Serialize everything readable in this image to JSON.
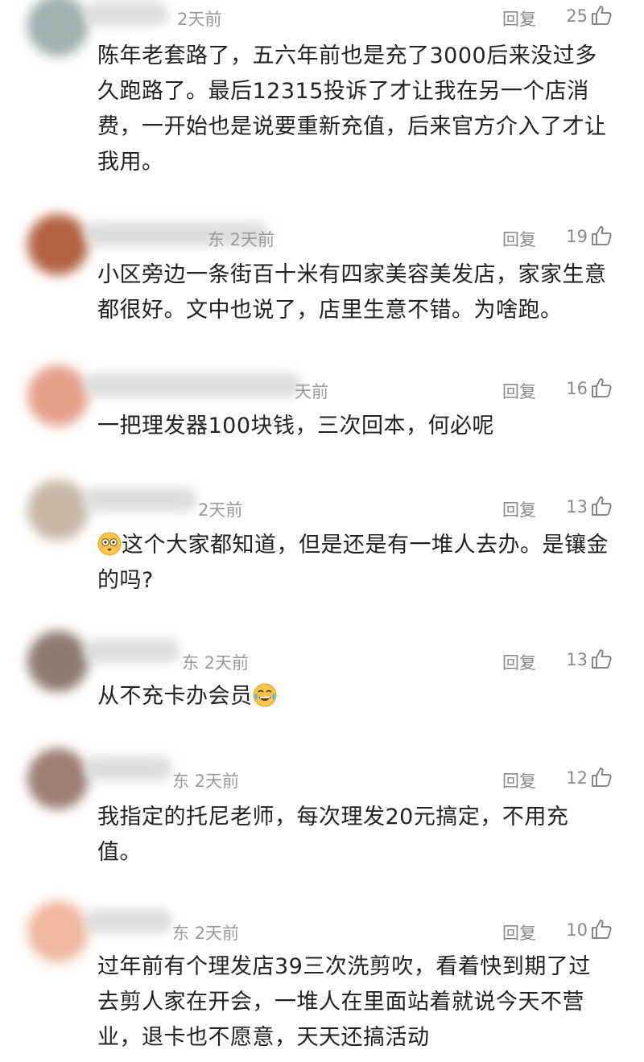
{
  "ui": {
    "reply_label": "回复"
  },
  "comments": [
    {
      "meta": "2天前",
      "likes": "25",
      "text": "陈年老套路了，五六年前也是充了3000后来没过多久跑路了。最后12315投诉了才让我在另一个店消费，一开始也是说要重新充值，后来官方介入了才让我用。",
      "avatar_color": "#9fb0ad"
    },
    {
      "meta": "东 2天前",
      "likes": "19",
      "text": "小区旁边一条街百十米有四家美容美发店，家家生意都很好。文中也说了，店里生意不错。为啥跑。",
      "avatar_color": "#b46442"
    },
    {
      "meta": "天前",
      "likes": "16",
      "text": "一把理发器100块钱，三次回本，何必呢",
      "avatar_color": "#e6a08a"
    },
    {
      "meta": "2天前",
      "likes": "13",
      "text_before": "",
      "emoji_before": "flushed-face-emoji",
      "text": "这个大家都知道，但是还是有一堆人去办。是镶金的吗?",
      "avatar_color": "#c9b7a6"
    },
    {
      "meta": "东 2天前",
      "likes": "13",
      "text": "从不充卡办会员",
      "emoji_after": "tears-of-joy-emoji",
      "avatar_color": "#8f7a6f"
    },
    {
      "meta": "东 2天前",
      "likes": "12",
      "text": "我指定的托尼老师，每次理发20元搞定，不用充值。",
      "avatar_color": "#9b7d72"
    },
    {
      "meta": "东 2天前",
      "likes": "10",
      "text": "过年前有个理发店39三次洗剪吹，看着快到期了过去剪人家在开会，一堆人在里面站着就说今天不营业，退卡也不愿意，天天还搞活动",
      "avatar_color": "#f0b79e"
    }
  ]
}
